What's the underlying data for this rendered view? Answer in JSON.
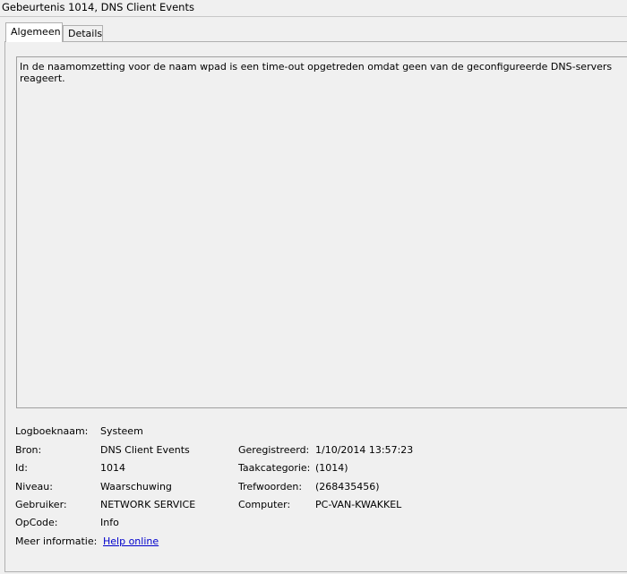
{
  "window": {
    "title": "Gebeurtenis 1014, DNS Client Events"
  },
  "tabs": [
    {
      "label": "Algemeen",
      "active": true
    },
    {
      "label": "Details",
      "active": false
    }
  ],
  "description": "In de naamomzetting voor de naam wpad is een time-out opgetreden omdat geen van de geconfigureerde DNS-servers reageert.",
  "fields": {
    "logboeknaam": {
      "label": "Logboeknaam:",
      "value": "Systeem"
    },
    "bron": {
      "label": "Bron:",
      "value": "DNS Client Events"
    },
    "id": {
      "label": "Id:",
      "value": "1014"
    },
    "niveau": {
      "label": "Niveau:",
      "value": "Waarschuwing"
    },
    "gebruiker": {
      "label": "Gebruiker:",
      "value": "NETWORK SERVICE"
    },
    "opcode": {
      "label": "OpCode:",
      "value": "Info"
    },
    "meer": {
      "label": "Meer informatie:",
      "value": "Help online"
    },
    "geregistreerd": {
      "label": "Geregistreerd:",
      "value": "1/10/2014 13:57:23"
    },
    "taakcategorie": {
      "label": "Taakcategorie:",
      "value": "(1014)"
    },
    "trefwoorden": {
      "label": "Trefwoorden:",
      "value": "(268435456)"
    },
    "computer": {
      "label": "Computer:",
      "value": "PC-VAN-KWAKKEL"
    }
  }
}
